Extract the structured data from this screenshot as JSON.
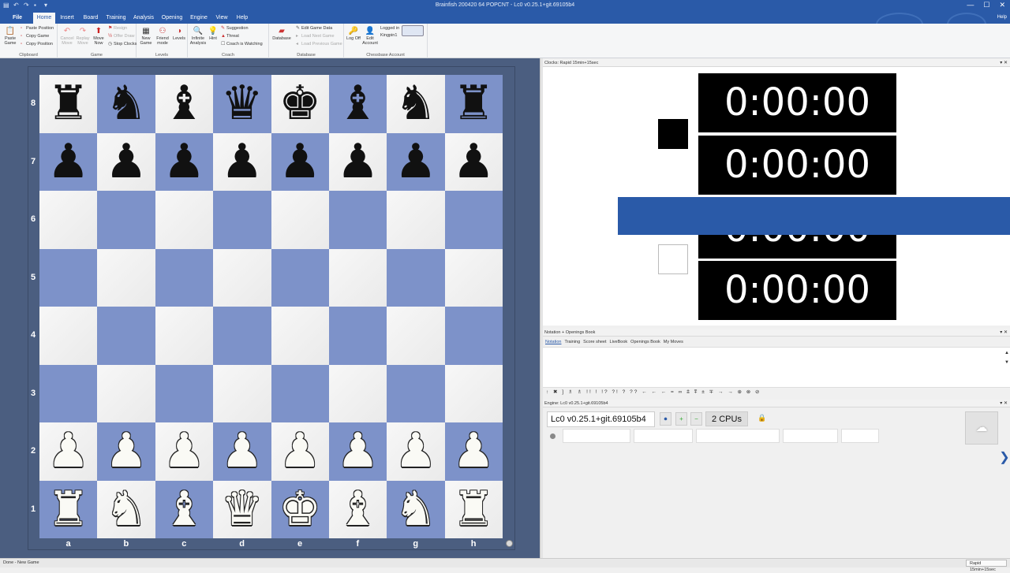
{
  "window": {
    "title": "Brainfish 200420 64 POPCNT - Lc0 v0.25.1+git.69105b4",
    "controls": [
      "—",
      "☐",
      "✕"
    ]
  },
  "menu": {
    "file": "File",
    "tabs": [
      "Home",
      "Insert",
      "Board",
      "Training",
      "Analysis",
      "Opening",
      "Engine",
      "View",
      "Help"
    ],
    "active": "Home",
    "help_right": "Help"
  },
  "ribbon": {
    "clipboard": {
      "label": "Clipboard",
      "paste_game": "Paste Game",
      "paste_position": "Paste Position",
      "copy_game": "Copy Game",
      "copy_position": "Copy Position"
    },
    "game": {
      "label": "Game",
      "cancel_move": "Cancel Move",
      "replay_move": "Replay Move",
      "move_now": "Move Now",
      "resign": "Resign",
      "offer_draw": "Offer Draw",
      "stop_clocks": "Stop Clocks"
    },
    "levels": {
      "label": "Levels",
      "new_game": "New Game",
      "friend_mode": "Friend mode",
      "levels": "Levels"
    },
    "coach": {
      "label": "Coach",
      "infinite_analysis": "Infinite Analysis",
      "hint": "Hint",
      "suggestion": "Suggestion",
      "threat": "Threat",
      "coach_is_watching": "Coach is Watching"
    },
    "database": {
      "label": "Database",
      "database": "Database",
      "edit_game_data": "Edit Game Data",
      "load_next_game": "Load Next Game",
      "load_previous_game": "Load Previous Game"
    },
    "account": {
      "label": "Chessbase Account",
      "log_off": "Log Off",
      "edit_account": "Edit Account",
      "logged_in": "Logged in",
      "user": "Kingpin1"
    }
  },
  "board": {
    "ranks": [
      "8",
      "7",
      "6",
      "5",
      "4",
      "3",
      "2",
      "1"
    ],
    "files": [
      "a",
      "b",
      "c",
      "d",
      "e",
      "f",
      "g",
      "h"
    ],
    "position": [
      [
        "r",
        "n",
        "b",
        "q",
        "k",
        "b",
        "n",
        "r"
      ],
      [
        "p",
        "p",
        "p",
        "p",
        "p",
        "p",
        "p",
        "p"
      ],
      [
        "",
        "",
        "",
        "",
        "",
        "",
        "",
        ""
      ],
      [
        "",
        "",
        "",
        "",
        "",
        "",
        "",
        ""
      ],
      [
        "",
        "",
        "",
        "",
        "",
        "",
        "",
        ""
      ],
      [
        "",
        "",
        "",
        "",
        "",
        "",
        "",
        ""
      ],
      [
        "P",
        "P",
        "P",
        "P",
        "P",
        "P",
        "P",
        "P"
      ],
      [
        "R",
        "N",
        "B",
        "Q",
        "K",
        "B",
        "N",
        "R"
      ]
    ],
    "glyphs": {
      "k": "♚",
      "q": "♛",
      "r": "♜",
      "b": "♝",
      "n": "♞",
      "p": "♟",
      "K": "♚",
      "Q": "♛",
      "R": "♜",
      "B": "♝",
      "N": "♞",
      "P": "♟"
    },
    "colors": {
      "light": "#f2f2f2",
      "dark": "#7d92c9",
      "frame": "#4b5e80"
    }
  },
  "clocks": {
    "header": "Clocks: Rapid 15min+15sec",
    "black_top": "0:00:00",
    "black_bottom": "0:00:00",
    "white_top": "0:00:00",
    "white_bottom": "0:00:00"
  },
  "notation": {
    "header": "Notation + Openings Book",
    "tabs": [
      "Notation",
      "Training",
      "Score sheet",
      "LiveBook",
      "Openings Book",
      "My Moves"
    ],
    "active_tab": "Notation",
    "symbols": "↑ ✖ ] ♗ ♗ !! ! !? ?! ? ?? ← ← ← = ∞ ⩲ ⩱ ± ∓ → → ⊕ ⊗ ⊘"
  },
  "engine": {
    "header": "Engine: Lc0 v0.25.1+git.69105b4",
    "name": "Lc0 v0.25.1+git.69105b4",
    "cpus": "2 CPUs"
  },
  "status": {
    "left": "Done - New Game",
    "right": "Rapid 15min+15sec"
  }
}
